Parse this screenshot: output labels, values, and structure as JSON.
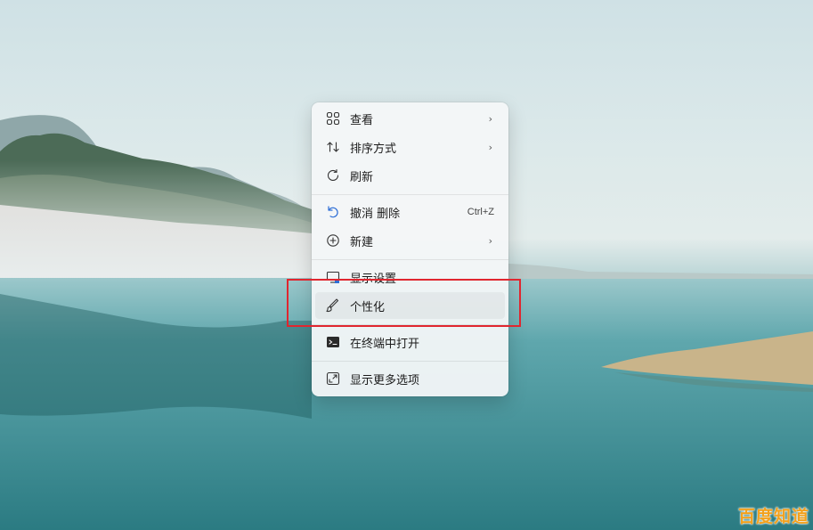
{
  "context_menu": {
    "items": [
      {
        "label": "查看",
        "icon": "grid-view-icon",
        "has_submenu": true
      },
      {
        "label": "排序方式",
        "icon": "sort-arrows-icon",
        "has_submenu": true
      },
      {
        "label": "刷新",
        "icon": "refresh-icon",
        "has_submenu": false
      },
      {
        "label": "撤消 删除",
        "icon": "undo-icon",
        "shortcut": "Ctrl+Z"
      },
      {
        "label": "新建",
        "icon": "add-circle-icon",
        "has_submenu": true
      },
      {
        "label": "显示设置",
        "icon": "display-icon"
      },
      {
        "label": "个性化",
        "icon": "brush-icon"
      },
      {
        "label": "在终端中打开",
        "icon": "terminal-icon"
      },
      {
        "label": "显示更多选项",
        "icon": "expand-icon"
      }
    ],
    "chevron": "›"
  },
  "annotation": {
    "highlight_color": "#e0262f"
  },
  "watermark": {
    "text": "百度知道",
    "color": "#f3a11d"
  }
}
